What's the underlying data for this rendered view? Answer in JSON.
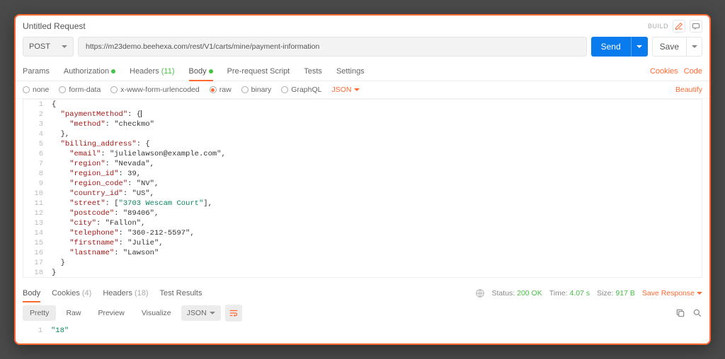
{
  "header": {
    "title": "Untitled Request",
    "build": "BUILD"
  },
  "request": {
    "method": "POST",
    "url": "https://m23demo.beehexa.com/rest/V1/carts/mine/payment-information",
    "send": "Send",
    "save": "Save"
  },
  "tabs": {
    "params": "Params",
    "auth": "Authorization",
    "headers": "Headers",
    "headers_count": "(11)",
    "body": "Body",
    "prereq": "Pre-request Script",
    "tests": "Tests",
    "settings": "Settings",
    "cookies": "Cookies",
    "code": "Code"
  },
  "bodytype": {
    "none": "none",
    "formdata": "form-data",
    "xwww": "x-www-form-urlencoded",
    "raw": "raw",
    "binary": "binary",
    "graphql": "GraphQL",
    "json": "JSON",
    "beautify": "Beautify"
  },
  "editor": [
    "{",
    "  \"paymentMethod\": {",
    "    \"method\": \"checkmo\"",
    "  },",
    "  \"billing_address\": {",
    "    \"email\": \"julielawson@example.com\",",
    "    \"region\": \"Nevada\",",
    "    \"region_id\": 39,",
    "    \"region_code\": \"NV\",",
    "    \"country_id\": \"US\",",
    "    \"street\": [\"3703 Wescam Court\"],",
    "    \"postcode\": \"89406\",",
    "    \"city\": \"Fallon\",",
    "    \"telephone\": \"360-212-5597\",",
    "    \"firstname\": \"Julie\",",
    "    \"lastname\": \"Lawson\"",
    "  }",
    "}"
  ],
  "resp_tabs": {
    "body": "Body",
    "cookies": "Cookies",
    "cookies_count": "(4)",
    "headers": "Headers",
    "headers_count": "(18)",
    "tests": "Test Results"
  },
  "status": {
    "label_status": "Status:",
    "status": "200 OK",
    "label_time": "Time:",
    "time": "4.07 s",
    "label_size": "Size:",
    "size": "917 B",
    "save": "Save Response"
  },
  "viewer": {
    "pretty": "Pretty",
    "raw": "Raw",
    "preview": "Preview",
    "visualize": "Visualize",
    "lang": "JSON"
  },
  "response": {
    "line1": "\"18\""
  }
}
